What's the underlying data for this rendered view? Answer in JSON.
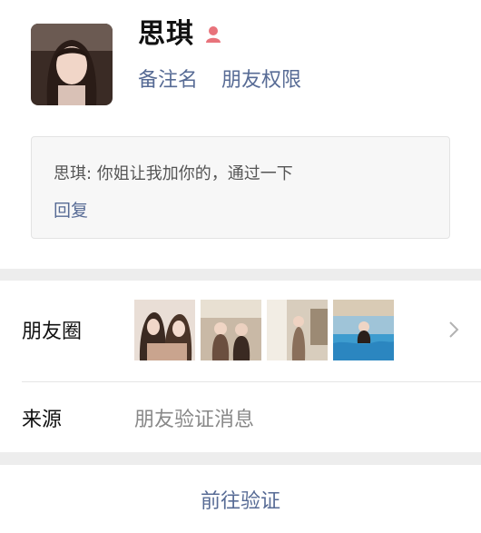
{
  "profile": {
    "name": "思琪",
    "gender_icon": "female-icon",
    "actions": {
      "remark": "备注名",
      "permissions": "朋友权限"
    }
  },
  "message": {
    "text": "思琪: 你姐让我加你的，通过一下",
    "reply": "回复"
  },
  "moments": {
    "label": "朋友圈",
    "photos": [
      "moments-photo-1",
      "moments-photo-2",
      "moments-photo-3",
      "moments-photo-4"
    ],
    "chevron_icon": "chevron-right-icon"
  },
  "source": {
    "label": "来源",
    "value": "朋友验证消息"
  },
  "verify": {
    "label": "前往验证"
  },
  "colors": {
    "link": "#576b95",
    "gender": "#e8737b",
    "page_bg": "#ededed"
  }
}
